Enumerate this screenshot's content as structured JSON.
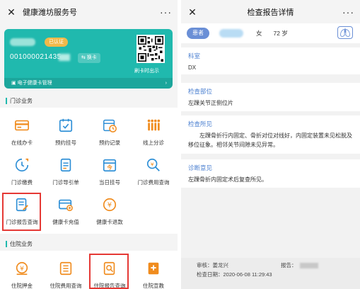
{
  "left": {
    "title": "健康潍坊服务号",
    "card": {
      "badge": "已认证",
      "card_no": "001000021435",
      "switch_label": "⇆ 换卡",
      "qr_tip": "刷卡时出示",
      "manage_label": "电子健康卡管理"
    },
    "outpatient": {
      "header": "门诊业务",
      "items": [
        {
          "label": "在线办卡",
          "icon": "card-icon"
        },
        {
          "label": "预约挂号",
          "icon": "check-calendar-icon"
        },
        {
          "label": "预约记录",
          "icon": "calendar-clock-icon"
        },
        {
          "label": "线上分诊",
          "icon": "queue-icon"
        },
        {
          "label": "门诊缴费",
          "icon": "payment-clock-icon"
        },
        {
          "label": "门诊导引单",
          "icon": "guide-doc-icon"
        },
        {
          "label": "当日挂号",
          "icon": "today-calendar-icon"
        },
        {
          "label": "门诊费用查询",
          "icon": "fee-search-icon"
        },
        {
          "label": "门诊报告查询",
          "icon": "report-doc-icon"
        },
        {
          "label": "健康卡充值",
          "icon": "card-recharge-icon"
        },
        {
          "label": "健康卡退款",
          "icon": "refund-coin-icon"
        }
      ]
    },
    "inpatient": {
      "header": "住院业务",
      "items": [
        {
          "label": "住院押金",
          "icon": "deposit-icon"
        },
        {
          "label": "住院费用查询",
          "icon": "fee-list-icon"
        },
        {
          "label": "住院报告查询",
          "icon": "inpatient-report-icon"
        },
        {
          "label": "住院宣教",
          "icon": "education-icon"
        }
      ]
    }
  },
  "right": {
    "title": "检查报告详情",
    "patient": {
      "badge": "患者",
      "sex": "女",
      "age": "72 岁"
    },
    "sections": [
      {
        "label": "科室",
        "text": "DX"
      },
      {
        "label": "检查部位",
        "text": "左踝关节正侧位片"
      },
      {
        "label": "检查所见",
        "text": "左踝骨折行内固定、骨折对位对线好，内固定装置未见松脱及移位征象。相邻关节间隙未见异常。"
      },
      {
        "label": "诊断意见",
        "text": "左踝骨折内固定术后复查所见。"
      }
    ],
    "footer": {
      "reviewer": "审核：姜龙兴",
      "reporter": "报告：",
      "time": "检查日期：2020-06-08 11:29:43"
    }
  },
  "colors": {
    "teal": "#20b9ae",
    "icon_blue": "#2e8fd6",
    "icon_orange": "#f08c1e",
    "label_blue": "#4a7fd0",
    "highlight_red": "#e53935"
  }
}
